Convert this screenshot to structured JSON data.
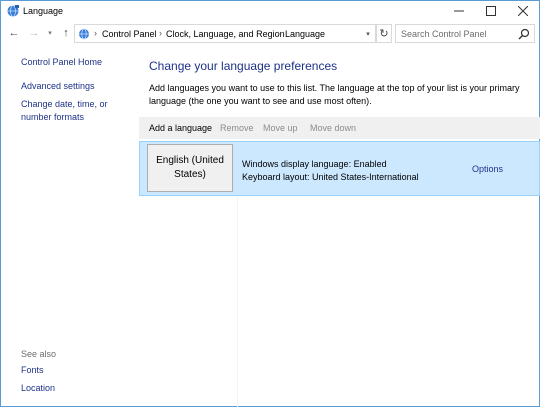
{
  "window": {
    "title": "Language",
    "icon": "language-globe-icon"
  },
  "titlebar_buttons": {
    "minimize": "—",
    "maximize": "☐",
    "close": "✕"
  },
  "nav": {
    "back": "←",
    "forward": "→",
    "recent": "▾",
    "up": "↑",
    "refresh": "↻",
    "dropdown": "▾"
  },
  "breadcrumb": {
    "items": [
      "Control Panel",
      "Clock, Language, and Region",
      "Language"
    ],
    "separator": "›"
  },
  "search": {
    "placeholder": "Search Control Panel"
  },
  "sidebar": {
    "home": "Control Panel Home",
    "links": [
      "Advanced settings",
      "Change date, time, or number formats"
    ],
    "see_also_label": "See also",
    "see_also_links": [
      "Fonts",
      "Location"
    ]
  },
  "main": {
    "heading": "Change your language preferences",
    "description": "Add languages you want to use to this list. The language at the top of your list is your primary language (the one you want to see and use most often).",
    "toolbar": {
      "add": "Add a language",
      "remove": "Remove",
      "move_up": "Move up",
      "move_down": "Move down"
    },
    "languages": [
      {
        "name": "English (United States)",
        "display_language": "Windows display language: Enabled",
        "keyboard_layout": "Keyboard layout: United States-International",
        "options": "Options"
      }
    ]
  },
  "colors": {
    "link": "#1e3287",
    "selection_bg": "#cce8ff",
    "selection_border": "#99d1ff",
    "toolbar_bg": "#f0f0f0",
    "disabled_text": "#8c8c8c",
    "window_border": "#5b9bd5"
  }
}
